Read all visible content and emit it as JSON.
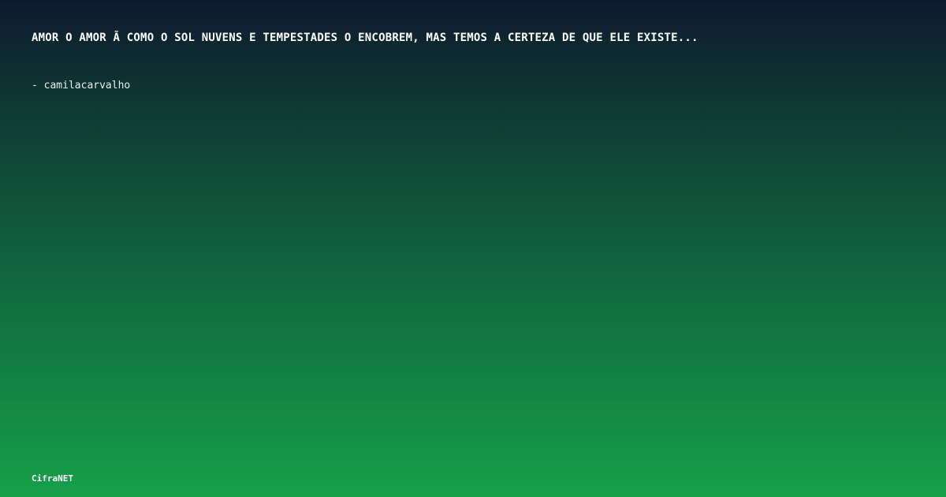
{
  "quote": {
    "text": "AMOR O AMOR Ã  COMO O SOL NUVENS E TEMPESTADES O ENCOBREM, MAS TEMOS A CERTEZA DE QUE ELE EXISTE..."
  },
  "author": {
    "text": "- camilacarvalho"
  },
  "brand": {
    "name": "CifraNET"
  },
  "colors": {
    "gradient_top": "#0d1a2e",
    "gradient_bottom": "#16a048",
    "text": "#ffffff"
  }
}
